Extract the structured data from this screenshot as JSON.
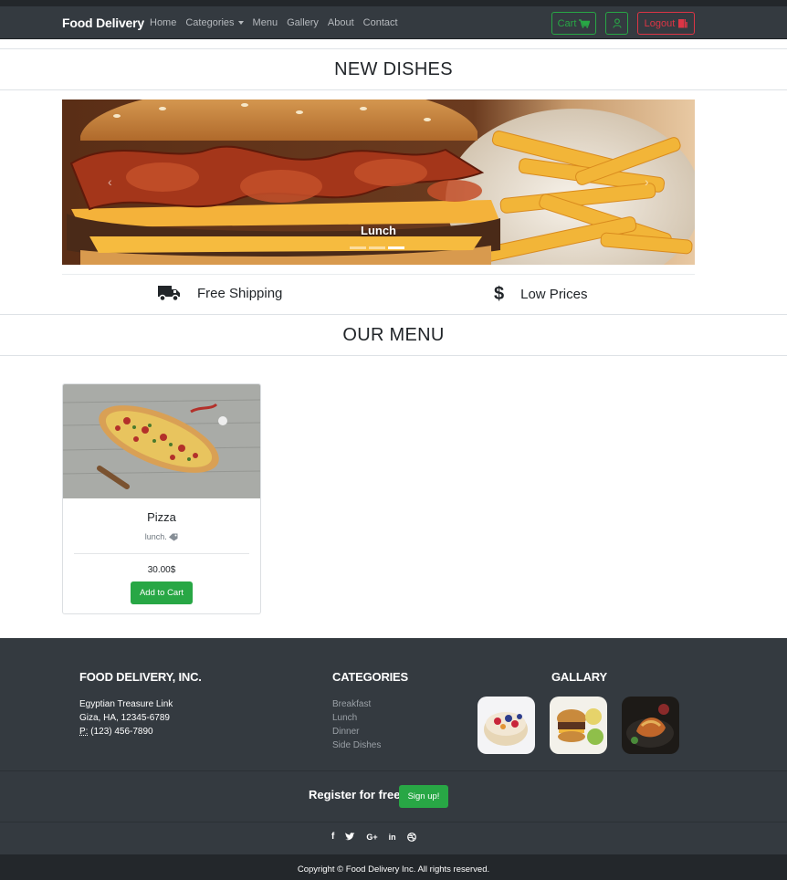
{
  "navbar": {
    "brand": "Food Delivery",
    "links": [
      "Home",
      "Categories",
      "Menu",
      "Gallery",
      "About",
      "Contact"
    ],
    "cart_label": "Cart",
    "logout_label": "Logout"
  },
  "new_dishes": {
    "heading": "NEW DISHES",
    "caption": "Lunch",
    "slides_count": 3,
    "active_slide": 3
  },
  "features": [
    {
      "icon": "truck-icon",
      "label": "Free Shipping"
    },
    {
      "icon": "dollar-icon",
      "label": "Low Prices"
    }
  ],
  "our_menu": {
    "heading": "OUR MENU",
    "items": [
      {
        "name": "Pizza",
        "tag": "lunch.",
        "price": "30.00$",
        "button": "Add to Cart"
      }
    ]
  },
  "footer": {
    "company_title": "FOOD DELIVERY, INC.",
    "address_line1": "Egyptian Treasure Link",
    "address_line2": "Giza, HA, 12345-6789",
    "phone_prefix": "P:",
    "phone": "(123) 456-7890",
    "categories_title": "CATEGORIES",
    "categories": [
      "Breakfast",
      "Lunch",
      "Dinner",
      "Side Dishes"
    ],
    "gallery_title": "GALLARY",
    "register_text": "Register for free",
    "signup_label": "Sign up!",
    "socials": [
      "f",
      "t",
      "G+",
      "in",
      "dribbble"
    ],
    "copyright": "Copyright © Food Delivery Inc. All rights reserved."
  },
  "colors": {
    "navbar": "#343a40",
    "success": "#28a745",
    "danger": "#dc3545"
  }
}
